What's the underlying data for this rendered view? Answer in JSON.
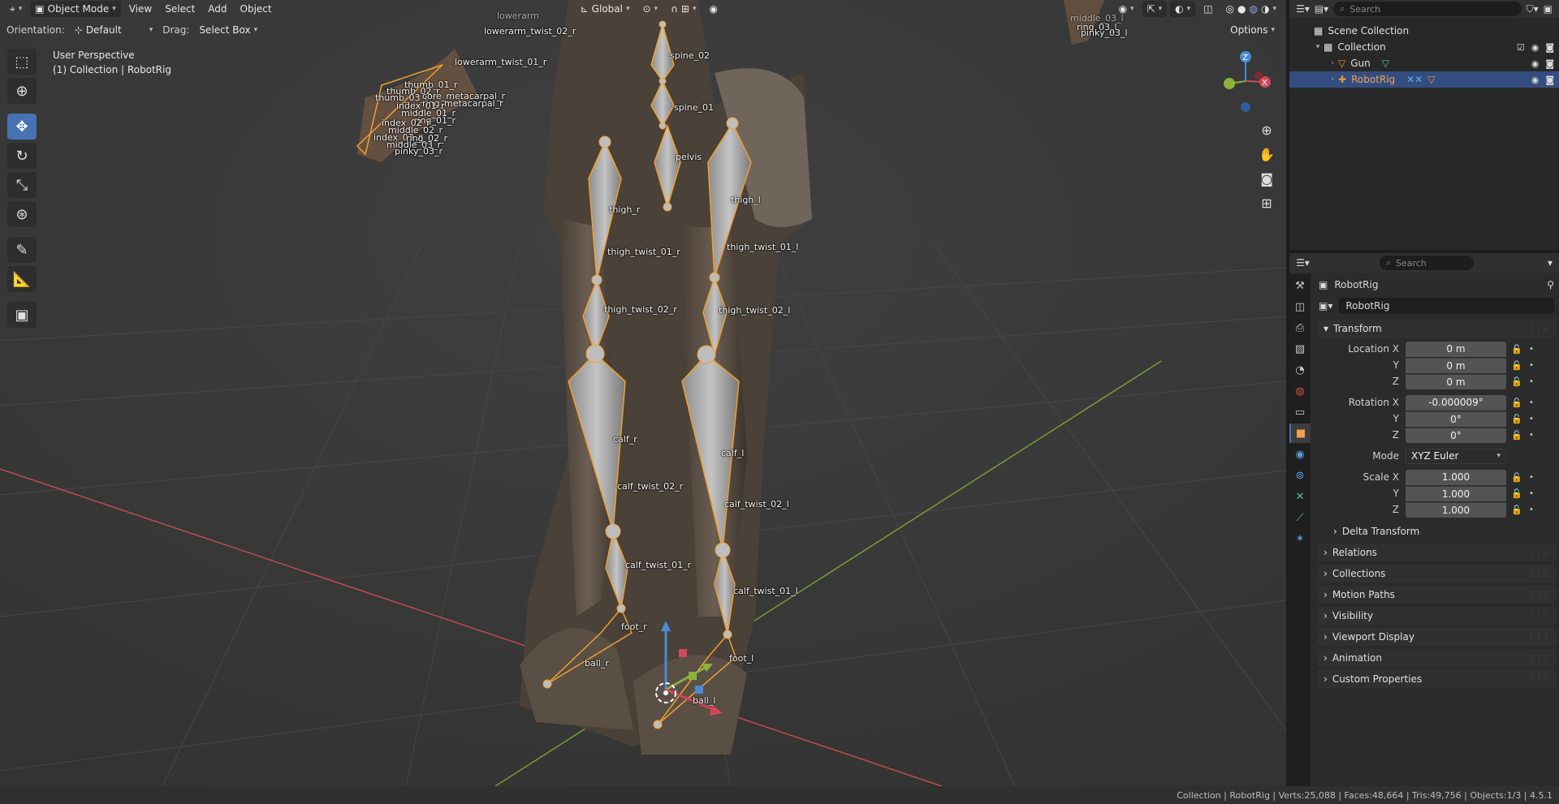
{
  "header": {
    "mode": "Object Mode",
    "menus": [
      "View",
      "Select",
      "Add",
      "Object"
    ],
    "transform_orientation": "Global",
    "orientation_label": "Orientation:",
    "orientation_value": "Default",
    "drag_label": "Drag:",
    "drag_value": "Select Box",
    "options": "Options"
  },
  "hud": {
    "view_name": "User Perspective",
    "context": "(1) Collection | RobotRig"
  },
  "toolbar": {
    "tools": [
      "select-box-icon",
      "cursor-icon",
      "move-icon",
      "rotate-icon",
      "scale-icon",
      "transform-icon",
      "annotate-icon",
      "measure-icon",
      "add-cube-icon"
    ],
    "active": "move-icon"
  },
  "navigation": {
    "gizmo_axes": [
      "X",
      "Y",
      "Z"
    ],
    "tools": [
      "zoom-icon",
      "pan-hand-icon",
      "camera-icon",
      "ortho-grid-icon"
    ]
  },
  "bones": {
    "labels": [
      "spine_02",
      "spine_01",
      "pelvis",
      "thigh_r",
      "thigh_l",
      "thigh_twist_01_r",
      "thigh_twist_01_l",
      "thigh_twist_02_r",
      "thigh_twist_02_l",
      "calf_r",
      "calf_l",
      "calf_twist_02_r",
      "calf_twist_02_l",
      "calf_twist_01_r",
      "calf_twist_01_l",
      "foot_r",
      "foot_l",
      "ball_r",
      "ball_l",
      "lowerarm_twist_02_r",
      "lowerarm_twist_01_r",
      "lowerarm",
      "thumb_01_r",
      "thumb_02_r",
      "thumb_03_r",
      "core_metacarpal_r",
      "ring_metacarpal_r",
      "index_01_r",
      "ring_01_r",
      "middle_01_r",
      "index_02_r",
      "middle_02_r",
      "index_03_r",
      "ring_02_r",
      "middle_03_r",
      "pinky_03_r",
      "middle_03_l",
      "ring_03_l",
      "pinky_03_l"
    ]
  },
  "outliner": {
    "search_placeholder": "Search",
    "scene_collection": "Scene Collection",
    "collection": "Collection",
    "items": [
      {
        "name": "Gun",
        "icon": "mesh-triangle-icon",
        "selected": false
      },
      {
        "name": "RobotRig",
        "icon": "armature-icon",
        "selected": true
      }
    ]
  },
  "properties": {
    "search_placeholder": "Search",
    "object_name": "RobotRig",
    "datablock_name": "RobotRig",
    "transform_title": "Transform",
    "location": {
      "label_x": "Location X",
      "x": "0 m",
      "y": "0 m",
      "z": "0 m"
    },
    "rotation": {
      "label_x": "Rotation X",
      "x": "-0.000009°",
      "y": "0°",
      "z": "0°"
    },
    "axis_y": "Y",
    "axis_z": "Z",
    "mode_label": "Mode",
    "mode_value": "XYZ Euler",
    "scale": {
      "label_x": "Scale X",
      "x": "1.000",
      "y": "1.000",
      "z": "1.000"
    },
    "delta_transform": "Delta Transform",
    "panels": [
      "Relations",
      "Collections",
      "Motion Paths",
      "Visibility",
      "Viewport Display",
      "Animation",
      "Custom Properties"
    ]
  },
  "statusbar": {
    "text": "Collection | RobotRig | Verts:25,088 | Faces:48,664 | Tris:49,756 | Objects:1/3 | 4.5.1"
  },
  "colors": {
    "accent": "#4772b3",
    "bone_outline": "#f0a030",
    "x_axis": "#d1475a",
    "y_axis": "#8db13c",
    "z_axis": "#4b8ad6"
  }
}
